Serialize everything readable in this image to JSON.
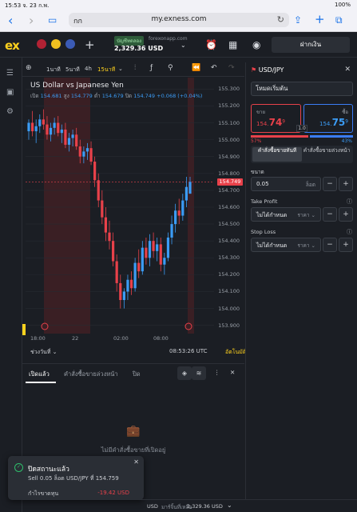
{
  "status": {
    "time_date": "15:53  จ. 23 ก.พ.",
    "battery": "100%"
  },
  "browser": {
    "aa_label": "กก",
    "host": "my.exness.com",
    "back": "‹",
    "forward": "›",
    "reload": "↻"
  },
  "header": {
    "logo": "ex",
    "account_badge": "บัญชีทดลอง",
    "server": "forexonapp.com",
    "balance": "2,329.36 USD",
    "deposit_label": "ฝากเงิน"
  },
  "chart_toolbar": {
    "tf1": "1นาที",
    "tf2": "5นาที",
    "tf3": "4h",
    "tf4": "15นาที"
  },
  "chart": {
    "title": "US Dollar vs Japanese Yen",
    "o_label": "เปิด",
    "o": "154.681",
    "h_label": "สูง",
    "h": "154.779",
    "l_label": "ต่ำ",
    "l": "154.679",
    "c_label": "ปิด",
    "c": "154.749",
    "change": "+0.068 (+0.04%)",
    "price_tag": "154.749",
    "range_label": "ช่วงวันที่ ⌄",
    "clock": "08:53:26 UTC",
    "auto_label": "อัตโนมัติ",
    "y_ticks": [
      "155.300",
      "155.200",
      "155.100",
      "155.000",
      "154.900",
      "154.800",
      "154.700",
      "154.600",
      "154.500",
      "154.400",
      "154.300",
      "154.200",
      "154.100",
      "154.000",
      "153.900"
    ],
    "x_ticks": [
      "18:00",
      "22",
      "02:00",
      "08:00"
    ]
  },
  "chart_data": {
    "type": "candlestick",
    "title": "US Dollar vs Japanese Yen",
    "ylim": [
      153.87,
      155.33
    ],
    "candles": [
      [
        155.05,
        155.12,
        155.0,
        155.1
      ],
      [
        155.1,
        155.17,
        155.02,
        155.05
      ],
      [
        155.05,
        155.12,
        154.98,
        155.08
      ],
      [
        155.08,
        155.15,
        155.04,
        155.12
      ],
      [
        155.12,
        155.18,
        155.06,
        155.09
      ],
      [
        155.09,
        155.14,
        155.0,
        155.03
      ],
      [
        155.03,
        155.1,
        154.99,
        155.07
      ],
      [
        155.07,
        155.13,
        155.03,
        155.1
      ],
      [
        155.1,
        155.14,
        155.02,
        155.04
      ],
      [
        155.04,
        155.09,
        154.98,
        155.06
      ],
      [
        155.06,
        155.1,
        154.95,
        154.97
      ],
      [
        154.97,
        155.04,
        154.93,
        155.01
      ],
      [
        155.01,
        155.06,
        154.96,
        155.03
      ],
      [
        155.03,
        155.07,
        154.94,
        154.96
      ],
      [
        154.96,
        155.0,
        154.86,
        154.9
      ],
      [
        154.9,
        154.96,
        154.86,
        154.93
      ],
      [
        154.93,
        154.98,
        154.88,
        154.95
      ],
      [
        154.95,
        154.99,
        154.85,
        154.87
      ],
      [
        154.87,
        154.9,
        154.72,
        154.76
      ],
      [
        154.76,
        154.8,
        154.6,
        154.64
      ],
      [
        154.64,
        154.7,
        154.5,
        154.54
      ],
      [
        154.54,
        154.6,
        154.4,
        154.45
      ],
      [
        154.45,
        154.52,
        154.35,
        154.4
      ],
      [
        154.4,
        154.45,
        154.25,
        154.28
      ],
      [
        154.28,
        154.32,
        154.1,
        154.15
      ],
      [
        154.15,
        154.2,
        154.0,
        154.05
      ],
      [
        154.05,
        154.12,
        154.0,
        154.1
      ],
      [
        154.1,
        154.2,
        154.05,
        154.17
      ],
      [
        154.17,
        154.22,
        154.08,
        154.12
      ],
      [
        154.12,
        154.3,
        154.1,
        154.27
      ],
      [
        154.27,
        154.35,
        154.18,
        154.22
      ],
      [
        154.22,
        154.4,
        154.2,
        154.36
      ],
      [
        154.36,
        154.42,
        154.26,
        154.3
      ],
      [
        154.3,
        154.44,
        154.25,
        154.4
      ],
      [
        154.4,
        154.45,
        154.3,
        154.34
      ],
      [
        154.34,
        154.42,
        154.28,
        154.38
      ],
      [
        154.38,
        154.42,
        154.22,
        154.26
      ],
      [
        154.26,
        154.33,
        154.2,
        154.3
      ],
      [
        154.3,
        154.45,
        154.28,
        154.42
      ],
      [
        154.42,
        154.55,
        154.38,
        154.5
      ],
      [
        154.5,
        154.62,
        154.45,
        154.58
      ],
      [
        154.58,
        154.65,
        154.5,
        154.55
      ],
      [
        154.55,
        154.68,
        154.52,
        154.64
      ],
      [
        154.64,
        154.78,
        154.6,
        154.72
      ],
      [
        154.68,
        154.78,
        154.68,
        154.75
      ]
    ]
  },
  "positions": {
    "tab_open": "เปิดแล้ว",
    "tab_pending": "คำสั่งซื้อขายล่วงหน้า",
    "tab_closed": "ปิด",
    "empty": "ไม่มีคำสั่งซื้อขายที่เปิดอยู่"
  },
  "toast": {
    "title": "ปิดสถานะแล้ว",
    "detail": "Sell 0.05 ล็อต USD/JPY ที่ 154.759",
    "pl_label": "กำไรขาดทุน",
    "pl_value": "-19.42 USD",
    "close": "✕"
  },
  "footer": {
    "left": "USD",
    "equity_label": "มาร์จิ้นที่เหลือ",
    "equity": "2,329.36 USD"
  },
  "order": {
    "symbol": "USD/JPY",
    "mode": "โหมดเริ่มต้น",
    "sell_label": "ขาย",
    "sell_main": "154.",
    "sell_big": "74",
    "sell_sup": "9",
    "buy_label": "ซื้อ",
    "buy_main": "154.",
    "buy_big": "75",
    "buy_sup": "9",
    "spread": "1.0",
    "sell_pct": "57%",
    "buy_pct": "43%",
    "sell_pct_value": 57,
    "tab_market": "คำสั่งซื้อขายทันที",
    "tab_pending": "คำสั่งซื้อขายล่วงหน้า",
    "volume_label": "ขนาด",
    "volume_value": "0.05",
    "volume_unit": "ล็อต",
    "tp_label": "Take Profit",
    "tp_value": "ไม่ได้กำหนด",
    "tp_unit": "ราคา ⌄",
    "sl_label": "Stop Loss",
    "sl_value": "ไม่ได้กำหนด",
    "sl_unit": "ราคา ⌄",
    "minus": "−",
    "plus": "+"
  }
}
